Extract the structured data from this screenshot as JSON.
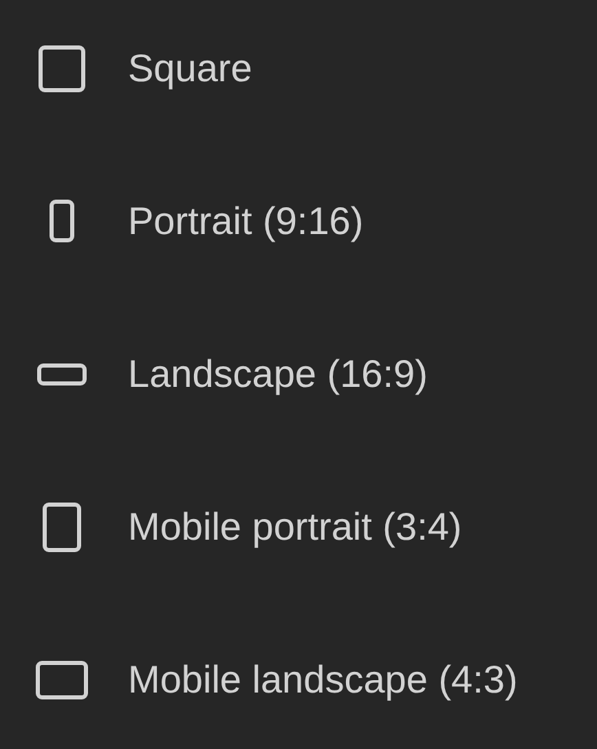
{
  "items": [
    {
      "kind": "square",
      "label": "Square"
    },
    {
      "kind": "portrait",
      "label": "Portrait (9:16)"
    },
    {
      "kind": "landscape",
      "label": "Landscape (16:9)"
    },
    {
      "kind": "mobile-portrait",
      "label": "Mobile portrait (3:4)"
    },
    {
      "kind": "mobile-landscape",
      "label": "Mobile landscape (4:3)"
    }
  ]
}
